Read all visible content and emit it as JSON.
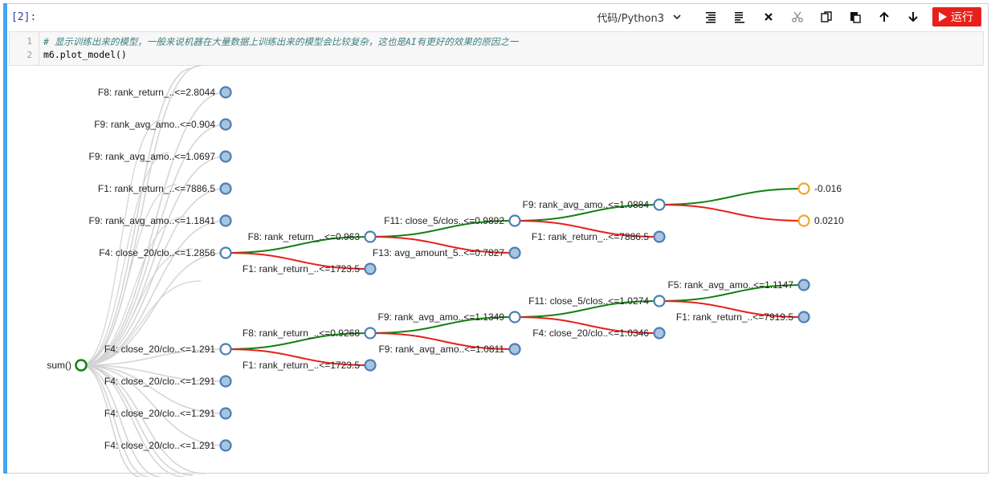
{
  "cell": {
    "prompt": "[2]:"
  },
  "toolbar": {
    "kernel": "代码/Python3",
    "run_label": "运行",
    "accent": "#e8201a",
    "icons": [
      "align-top-icon",
      "align-bottom-icon",
      "delete-icon",
      "cut-icon",
      "copy-icon",
      "paste-icon",
      "move-up-icon",
      "move-down-icon"
    ]
  },
  "editor": {
    "lines": [
      {
        "number": "1",
        "text": "# 显示训练出来的模型，一般来说机器在大量数据上训练出来的模型会比较复杂，这也是AI有更好的效果的原因之一"
      },
      {
        "number": "2",
        "text": "m6.plot_model()"
      }
    ]
  },
  "tree": {
    "colors": {
      "yes": "#128012",
      "no": "#e8201a",
      "faded": "#d3d3d3",
      "node_fill": "#a8c4e0",
      "node_stroke": "#4a7fb5",
      "leaf_stroke": "#f5a623",
      "root_stroke": "#128012"
    },
    "root": {
      "label": "sum()"
    },
    "nodes": [
      {
        "id": "l1a",
        "label": "F8: rank_return_..<=2.8044"
      },
      {
        "id": "l1b",
        "label": "F9: rank_avg_amo..<=0.904"
      },
      {
        "id": "l1c",
        "label": "F9: rank_avg_amo..<=1.0697"
      },
      {
        "id": "l1d",
        "label": "F1: rank_return_..<=7886.5"
      },
      {
        "id": "l1e",
        "label": "F9: rank_avg_amo..<=1.1841"
      },
      {
        "id": "t1",
        "label": "F4: close_20/clo..<=1.2856"
      },
      {
        "id": "t1a",
        "label": "F8: rank_return_..<=0.963"
      },
      {
        "id": "t1b",
        "label": "F1: rank_return_..<=1723.5"
      },
      {
        "id": "t1aa",
        "label": "F11: close_5/clos..<=0.9892"
      },
      {
        "id": "t1ab",
        "label": "F13: avg_amount_5..<=0.7827"
      },
      {
        "id": "t1aaa",
        "label": "F9: rank_avg_amo..<=1.0884"
      },
      {
        "id": "t1aab",
        "label": "F1: rank_return_..<=7886.5"
      },
      {
        "id": "leaf1",
        "label": "-0.016",
        "leaf": true
      },
      {
        "id": "leaf2",
        "label": "0.0210",
        "leaf": true
      },
      {
        "id": "t2",
        "label": "F4: close_20/clo..<=1.291"
      },
      {
        "id": "t2a",
        "label": "F8: rank_return_..<=0.9268"
      },
      {
        "id": "t2b",
        "label": "F1: rank_return_..<=1723.5"
      },
      {
        "id": "t2aa",
        "label": "F9: rank_avg_amo..<=1.1349"
      },
      {
        "id": "t2ab",
        "label": "F9: rank_avg_amo..<=1.0811"
      },
      {
        "id": "t2aaa",
        "label": "F11: close_5/clos..<=1.0274"
      },
      {
        "id": "t2aab",
        "label": "F4: close_20/clo..<=1.0346"
      },
      {
        "id": "t2aaaa",
        "label": "F5: rank_avg_amo..<=1.1147"
      },
      {
        "id": "t2aaab",
        "label": "F1: rank_return_..<=7919.5"
      },
      {
        "id": "l2a",
        "label": "F4: close_20/clo..<=1.291"
      },
      {
        "id": "l2b",
        "label": "F4: close_20/clo..<=1.291"
      },
      {
        "id": "l2c",
        "label": "F4: close_20/clo..<=1.291"
      }
    ],
    "edges": [
      {
        "from": "t1",
        "to": "t1a",
        "kind": "yes"
      },
      {
        "from": "t1",
        "to": "t1b",
        "kind": "no"
      },
      {
        "from": "t1a",
        "to": "t1aa",
        "kind": "yes"
      },
      {
        "from": "t1a",
        "to": "t1ab",
        "kind": "no"
      },
      {
        "from": "t1aa",
        "to": "t1aaa",
        "kind": "yes"
      },
      {
        "from": "t1aa",
        "to": "t1aab",
        "kind": "no"
      },
      {
        "from": "t1aaa",
        "to": "leaf1",
        "kind": "yes"
      },
      {
        "from": "t1aaa",
        "to": "leaf2",
        "kind": "no"
      },
      {
        "from": "t2",
        "to": "t2a",
        "kind": "yes"
      },
      {
        "from": "t2",
        "to": "t2b",
        "kind": "no"
      },
      {
        "from": "t2a",
        "to": "t2aa",
        "kind": "yes"
      },
      {
        "from": "t2a",
        "to": "t2ab",
        "kind": "no"
      },
      {
        "from": "t2aa",
        "to": "t2aaa",
        "kind": "yes"
      },
      {
        "from": "t2aa",
        "to": "t2aab",
        "kind": "no"
      },
      {
        "from": "t2aaa",
        "to": "t2aaaa",
        "kind": "yes"
      },
      {
        "from": "t2aaa",
        "to": "t2aaab",
        "kind": "no"
      }
    ]
  }
}
